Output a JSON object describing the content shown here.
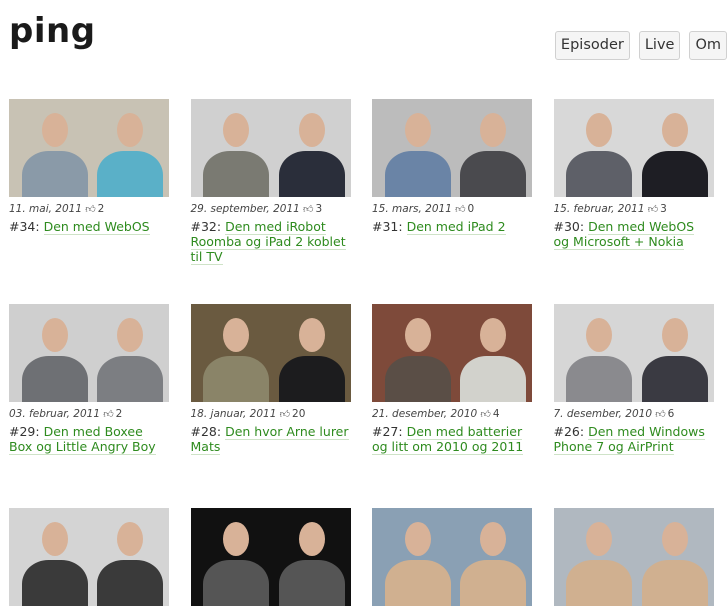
{
  "site": {
    "logo": "ping"
  },
  "nav": {
    "items": [
      "Episoder",
      "Live",
      "Om"
    ]
  },
  "episodes": [
    {
      "date": "11. mai, 2011",
      "likes": "2",
      "number": "#34:",
      "title": "Den med WebOS",
      "thumb": {
        "bg": "#c8c2b4",
        "left": "#8a9aa8",
        "right": "#5ab0c8"
      }
    },
    {
      "date": "29. september, 2011",
      "likes": "3",
      "number": "#32:",
      "title": "Den med iRobot Roomba og iPad 2 koblet til TV",
      "thumb": {
        "bg": "#d0d0d0",
        "left": "#7a7a72",
        "right": "#2a2e3a"
      }
    },
    {
      "date": "15. mars, 2011",
      "likes": "0",
      "number": "#31:",
      "title": "Den med iPad 2",
      "thumb": {
        "bg": "#bcbcbc",
        "left": "#6a84a6",
        "right": "#4a4a4e"
      }
    },
    {
      "date": "15. februar, 2011",
      "likes": "3",
      "number": "#30:",
      "title": "Den med WebOS og Microsoft + Nokia",
      "thumb": {
        "bg": "#d8d8d8",
        "left": "#5e6068",
        "right": "#1e1e24"
      }
    },
    {
      "date": "03. februar, 2011",
      "likes": "2",
      "number": "#29:",
      "title": "Den med Boxee Box og Little Angry Boy",
      "thumb": {
        "bg": "#cfcfcf",
        "left": "#6e7074",
        "right": "#7c7e82"
      }
    },
    {
      "date": "18. januar, 2011",
      "likes": "20",
      "number": "#28:",
      "title": "Den hvor Arne lurer Mats",
      "thumb": {
        "bg": "#6a5a40",
        "left": "#8a8468",
        "right": "#1c1c1e"
      }
    },
    {
      "date": "21. desember, 2010",
      "likes": "4",
      "number": "#27:",
      "title": "Den med batterier og litt om 2010 og 2011",
      "thumb": {
        "bg": "#7e4a3a",
        "left": "#5a4e46",
        "right": "#d2d2cc"
      }
    },
    {
      "date": "7. desember, 2010",
      "likes": "6",
      "number": "#26:",
      "title": "Den med Windows Phone 7 og AirPrint",
      "thumb": {
        "bg": "#d6d6d6",
        "left": "#8a8a8e",
        "right": "#3a3a42"
      }
    },
    {
      "date": "",
      "likes": "",
      "number": "",
      "title": "",
      "thumb": {
        "bg": "#d4d4d4",
        "left": "#3a3a3a",
        "right": "#3a3a3a"
      }
    },
    {
      "date": "",
      "likes": "",
      "number": "",
      "title": "",
      "thumb": {
        "bg": "#111111",
        "left": "#555555",
        "right": "#555555"
      }
    },
    {
      "date": "",
      "likes": "",
      "number": "",
      "title": "",
      "thumb": {
        "bg": "#8aa0b4",
        "left": "#d0b090",
        "right": "#d0b090"
      }
    },
    {
      "date": "",
      "likes": "",
      "number": "",
      "title": "",
      "thumb": {
        "bg": "#b0b8c0",
        "left": "#d0b090",
        "right": "#d0b090"
      }
    }
  ]
}
